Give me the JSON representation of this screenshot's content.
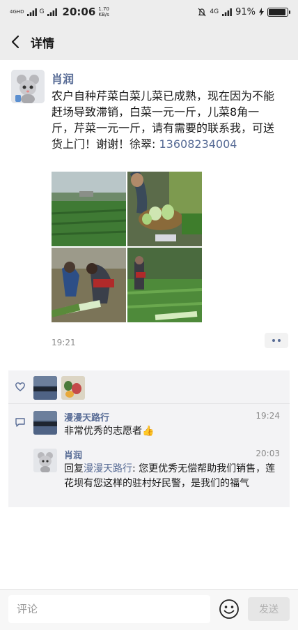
{
  "status_bar": {
    "network_left": "4G",
    "network_hd": "HD",
    "network_sub": "G",
    "time": "20:06",
    "speed_value": "1.70",
    "speed_unit": "KB/s",
    "network_right": "4G",
    "battery": "91%",
    "battery_level": 0.91
  },
  "nav": {
    "title": "详情"
  },
  "post": {
    "author": "肖润",
    "text": "农户自种芹菜白菜儿菜已成熟，现在因为不能赶场导致滞销，白菜一元一斤，儿菜8角一斤，芹菜一元一斤，请有需要的联系我，可送货上门！谢谢！徐翠: ",
    "phone": "13608234004",
    "time": "19:21",
    "photos": [
      "field-photo",
      "vegetable-basket-photo",
      "harvesting-photo",
      "celery-field-photo"
    ]
  },
  "interactions": {
    "comments": [
      {
        "author": "漫漫天路行",
        "time": "19:24",
        "text": "非常优秀的志愿者",
        "emoji": "👍"
      },
      {
        "author": "肖润",
        "time": "20:03",
        "reply_prefix": "回复",
        "reply_to": "漫漫天路行",
        "text": ": 您更优秀无偿帮助我们销售，莲花坝有您这样的驻村好民警，是我们的福气"
      }
    ]
  },
  "bottom_bar": {
    "input_placeholder": "评论",
    "send_label": "发送"
  },
  "colors": {
    "link_blue": "#576b95",
    "bar_gray": "#ededed",
    "panel_gray": "#f3f3f5"
  }
}
